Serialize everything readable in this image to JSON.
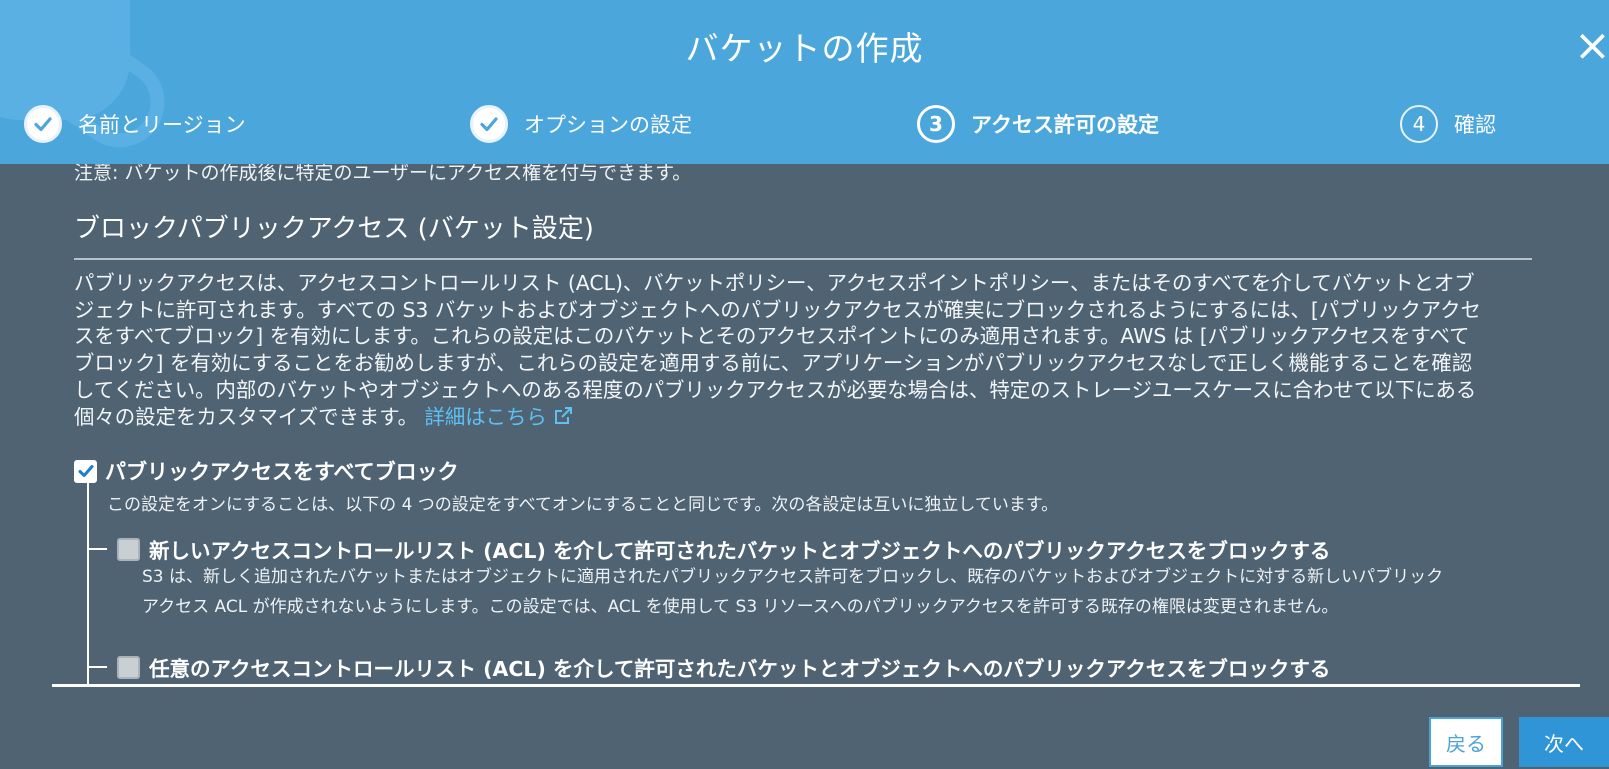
{
  "header": {
    "title": "バケットの作成",
    "close_label": "×",
    "steps": [
      {
        "label": "名前とリージョン",
        "state": "done"
      },
      {
        "label": "オプションの設定",
        "state": "done"
      },
      {
        "label": "アクセス許可の設定",
        "state": "current",
        "number": "3"
      },
      {
        "label": "確認",
        "state": "pending",
        "number": "4"
      }
    ]
  },
  "content": {
    "note": "注意: バケットの作成後に特定のユーザーにアクセス権を付与できます。",
    "section_title": "ブロックパブリックアクセス (バケット設定)",
    "description_lines": [
      "パブリックアクセスは、アクセスコントロールリスト (ACL)、バケットポリシー、アクセスポイントポリシー、またはそのすべてを介してバケットとオブ",
      "ジェクトに許可されます。すべての S3 バケットおよびオブジェクトへのパブリックアクセスが確実にブロックされるようにするには、[パブリックアクセ",
      "スをすべてブロック] を有効にします。これらの設定はこのバケットとそのアクセスポイントにのみ適用されます。AWS は [パブリックアクセスをすべて",
      "ブロック] を有効にすることをお勧めしますが、これらの設定を適用する前に、アプリケーションがパブリックアクセスなしで正しく機能することを確認",
      "してください。内部のバケットやオブジェクトへのある程度のパブリックアクセスが必要な場合は、特定のストレージユースケースに合わせて以下にある",
      "個々の設定をカスタマイズできます。"
    ],
    "learn_more": "詳細はこちら",
    "block_all": {
      "label": "パブリックアクセスをすべてブロック",
      "checked": true,
      "description": "この設定をオンにすることは、以下の 4 つの設定をすべてオンにすることと同じです。次の各設定は互いに独立しています。"
    },
    "options": [
      {
        "label": "新しいアクセスコントロールリスト (ACL) を介して許可されたバケットとオブジェクトへのパブリックアクセスをブロックする",
        "desc_line1": "S3 は、新しく追加されたバケットまたはオブジェクトに適用されたパブリックアクセス許可をブロックし、既存のバケットおよびオブジェクトに対する新しいパブリック",
        "desc_line2": "アクセス ACL が作成されないようにします。この設定では、ACL を使用して S3 リソースへのパブリックアクセスを許可する既存の権限は変更されません。"
      },
      {
        "label": "任意のアクセスコントロールリスト (ACL) を介して許可されたバケットとオブジェクトへのパブリックアクセスをブロックする"
      }
    ]
  },
  "footer": {
    "back_label": "戻る",
    "next_label": "次へ"
  },
  "colors": {
    "header_bg": "#4ba6dc",
    "body_bg": "#4f6373",
    "link": "#5fc0f3",
    "primary_button": "#2f95d7"
  }
}
